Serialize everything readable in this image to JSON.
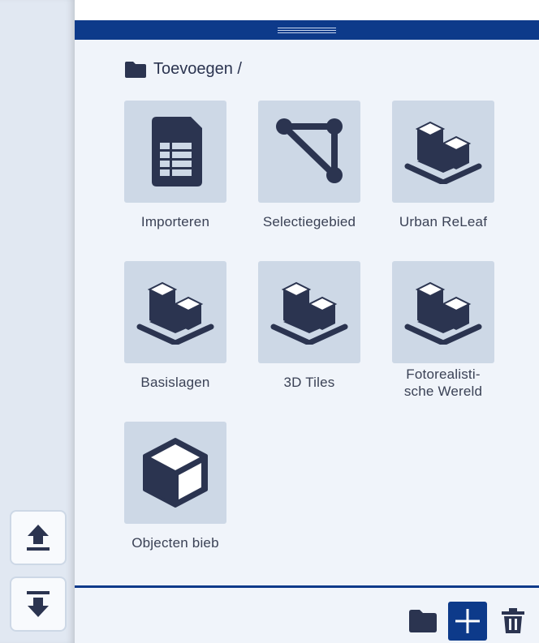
{
  "breadcrumb": {
    "label": "Toevoegen /"
  },
  "tiles": [
    {
      "label": "Importeren",
      "icon": "spreadsheet-icon"
    },
    {
      "label": "Selectiegebied",
      "icon": "polygon-select-icon"
    },
    {
      "label": "Urban ReLeaf",
      "icon": "buildings-layer-icon"
    },
    {
      "label": "Basislagen",
      "icon": "buildings-layer-icon"
    },
    {
      "label": "3D Tiles",
      "icon": "buildings-layer-icon"
    },
    {
      "label_line1": "Fotorealisti-",
      "label_line2": "sche Wereld",
      "icon": "buildings-layer-icon"
    },
    {
      "label": "Objecten bieb",
      "icon": "cube-icon"
    }
  ],
  "rail": {
    "upload_icon": "upload-icon",
    "download_icon": "download-icon"
  },
  "bottom_bar": {
    "folder_icon": "folder-icon",
    "add_icon": "plus-icon",
    "delete_icon": "trash-icon"
  },
  "colors": {
    "accent": "#0d3a8a",
    "icon_dark": "#2b3450",
    "tile_bg": "#cdd8e6",
    "panel_bg": "#f0f4fa",
    "rail_bg": "#e1e8f2"
  }
}
